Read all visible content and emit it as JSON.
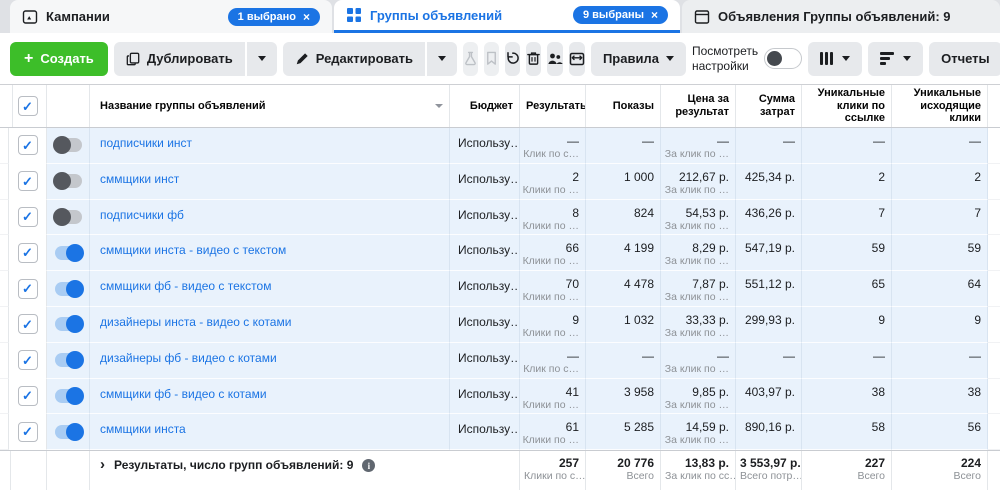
{
  "tabs": [
    {
      "label": "Кампании",
      "badge": "1 выбрано",
      "badge_close": "×"
    },
    {
      "label": "Группы объявлений",
      "badge": "9 выбраны",
      "badge_close": "×"
    },
    {
      "label": "Объявления Группы объявлений: 9"
    }
  ],
  "toolbar": {
    "create": "Создать",
    "duplicate": "Дублировать",
    "edit": "Редактировать",
    "rules": "Правила",
    "view_settings": "Посмотреть настройки",
    "reports": "Отчеты"
  },
  "table": {
    "headers": {
      "name": "Название группы объявлений",
      "budget": "Бюджет",
      "results": "Результаты",
      "impressions": "Показы",
      "cost_per_result": "Цена за результат",
      "amount_spent": "Сумма затрат",
      "unique_link_clicks": "Уникальные клики по ссылке",
      "unique_outbound_clicks": "Уникальные исходящие клики"
    },
    "rows": [
      {
        "name": "подписчики инст",
        "enabled": false,
        "budget": "Использу…",
        "results": "—",
        "results_sub": "Клик по с…",
        "impressions": "—",
        "cost": "—",
        "cost_sub": "За клик по …",
        "spent": "—",
        "unique_link": "—",
        "unique_out": "—"
      },
      {
        "name": "сммщики инст",
        "enabled": false,
        "budget": "Использу…",
        "results": "2",
        "results_sub": "Клики по …",
        "impressions": "1 000",
        "cost": "212,67 р.",
        "cost_sub": "За клик по …",
        "spent": "425,34 р.",
        "unique_link": "2",
        "unique_out": "2"
      },
      {
        "name": "подписчики фб",
        "enabled": false,
        "budget": "Использу…",
        "results": "8",
        "results_sub": "Клики по …",
        "impressions": "824",
        "cost": "54,53 р.",
        "cost_sub": "За клик по …",
        "spent": "436,26 р.",
        "unique_link": "7",
        "unique_out": "7"
      },
      {
        "name": "сммщики инста - видео с текстом",
        "enabled": true,
        "budget": "Использу…",
        "results": "66",
        "results_sub": "Клики по …",
        "impressions": "4 199",
        "cost": "8,29 р.",
        "cost_sub": "За клик по …",
        "spent": "547,19 р.",
        "unique_link": "59",
        "unique_out": "59"
      },
      {
        "name": "сммщики фб - видео с текстом",
        "enabled": true,
        "budget": "Использу…",
        "results": "70",
        "results_sub": "Клики по …",
        "impressions": "4 478",
        "cost": "7,87 р.",
        "cost_sub": "За клик по …",
        "spent": "551,12 р.",
        "unique_link": "65",
        "unique_out": "64"
      },
      {
        "name": "дизайнеры инста - видео с котами",
        "enabled": true,
        "budget": "Использу…",
        "results": "9",
        "results_sub": "Клики по …",
        "impressions": "1 032",
        "cost": "33,33 р.",
        "cost_sub": "За клик по …",
        "spent": "299,93 р.",
        "unique_link": "9",
        "unique_out": "9"
      },
      {
        "name": "дизайнеры фб - видео с котами",
        "enabled": true,
        "budget": "Использу…",
        "results": "—",
        "results_sub": "Клик по с…",
        "impressions": "—",
        "cost": "—",
        "cost_sub": "За клик по …",
        "spent": "—",
        "unique_link": "—",
        "unique_out": "—"
      },
      {
        "name": "сммщики фб - видео с котами",
        "enabled": true,
        "budget": "Использу…",
        "results": "41",
        "results_sub": "Клики по …",
        "impressions": "3 958",
        "cost": "9,85 р.",
        "cost_sub": "За клик по …",
        "spent": "403,97 р.",
        "unique_link": "38",
        "unique_out": "38"
      },
      {
        "name": "сммщики инста",
        "enabled": true,
        "budget": "Использу…",
        "results": "61",
        "results_sub": "Клики по …",
        "impressions": "5 285",
        "cost": "14,59 р.",
        "cost_sub": "За клик по …",
        "spent": "890,16 р.",
        "unique_link": "58",
        "unique_out": "56"
      }
    ],
    "footer": {
      "label": "Результаты, число групп объявлений: 9",
      "results": "257",
      "results_sub": "Клики по с…",
      "impressions": "20 776",
      "impressions_sub": "Всего",
      "cost": "13,83 р.",
      "cost_sub": "За клик по сс…",
      "spent": "3 553,97 р.",
      "spent_sub": "Всего потр…",
      "unique_link": "227",
      "unique_link_sub": "Всего",
      "unique_out": "224",
      "unique_out_sub": "Всего"
    }
  },
  "colors": {
    "accent": "#1b74e4",
    "create_green": "#3dbe29",
    "selected_row": "#e9f2fc"
  }
}
